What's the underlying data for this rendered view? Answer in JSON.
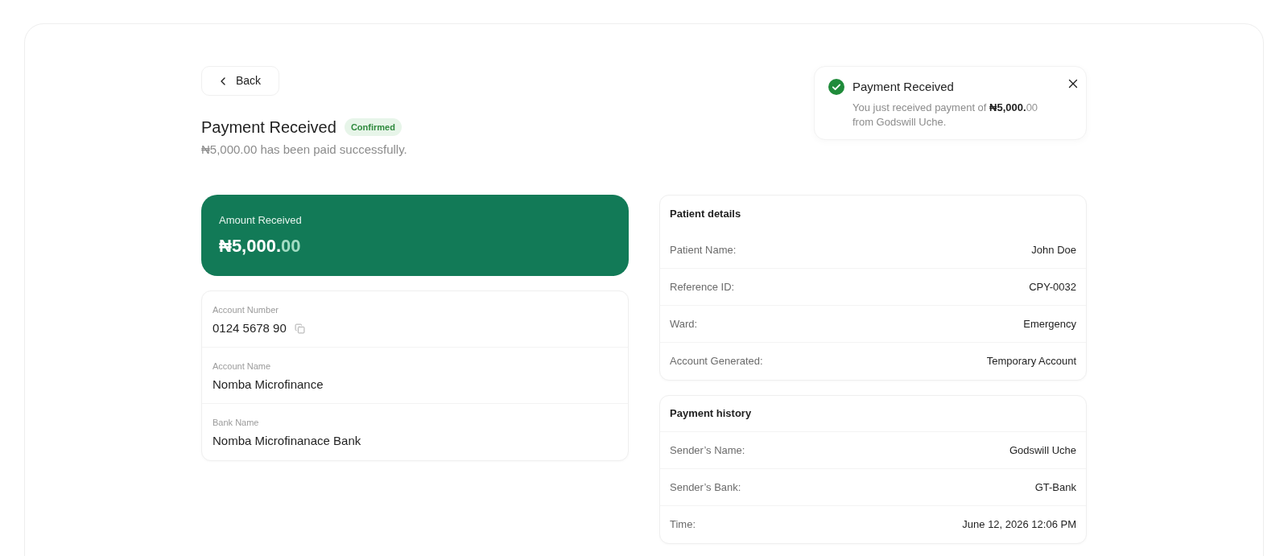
{
  "back_button": {
    "label": "Back"
  },
  "header": {
    "title": "Payment Received",
    "badge": "Confirmed",
    "subtitle": "₦5,000.00 has been paid successfully."
  },
  "toast": {
    "title": "Payment Received",
    "message_start": "You just received payment of",
    "amount": "₦5,000.",
    "amount_decimals": "00",
    "message_end": "from Godswill Uche."
  },
  "amount_card": {
    "label": "Amount Received",
    "amount": "₦5,000.",
    "decimals": "00"
  },
  "account_details": [
    {
      "label": "Account Number",
      "value": "0124 5678 90",
      "copyable": true
    },
    {
      "label": "Account Name",
      "value": "Nomba Microfinance",
      "copyable": false
    },
    {
      "label": "Bank Name",
      "value": "Nomba Microfinanace Bank",
      "copyable": false
    }
  ],
  "patient_details": {
    "title": "Patient details",
    "rows": [
      {
        "label": "Patient Name:",
        "value": "John Doe"
      },
      {
        "label": "Reference ID:",
        "value": "CPY-0032"
      },
      {
        "label": "Ward:",
        "value": "Emergency"
      },
      {
        "label": "Account Generated:",
        "value": "Temporary Account"
      }
    ]
  },
  "payment_history": {
    "title": "Payment history",
    "rows": [
      {
        "label": "Sender’s Name:",
        "value": "Godswill Uche"
      },
      {
        "label": "Sender’s Bank:",
        "value": "GT-Bank"
      },
      {
        "label": "Time:",
        "value": "June 12, 2026 12:06 PM"
      }
    ]
  }
}
